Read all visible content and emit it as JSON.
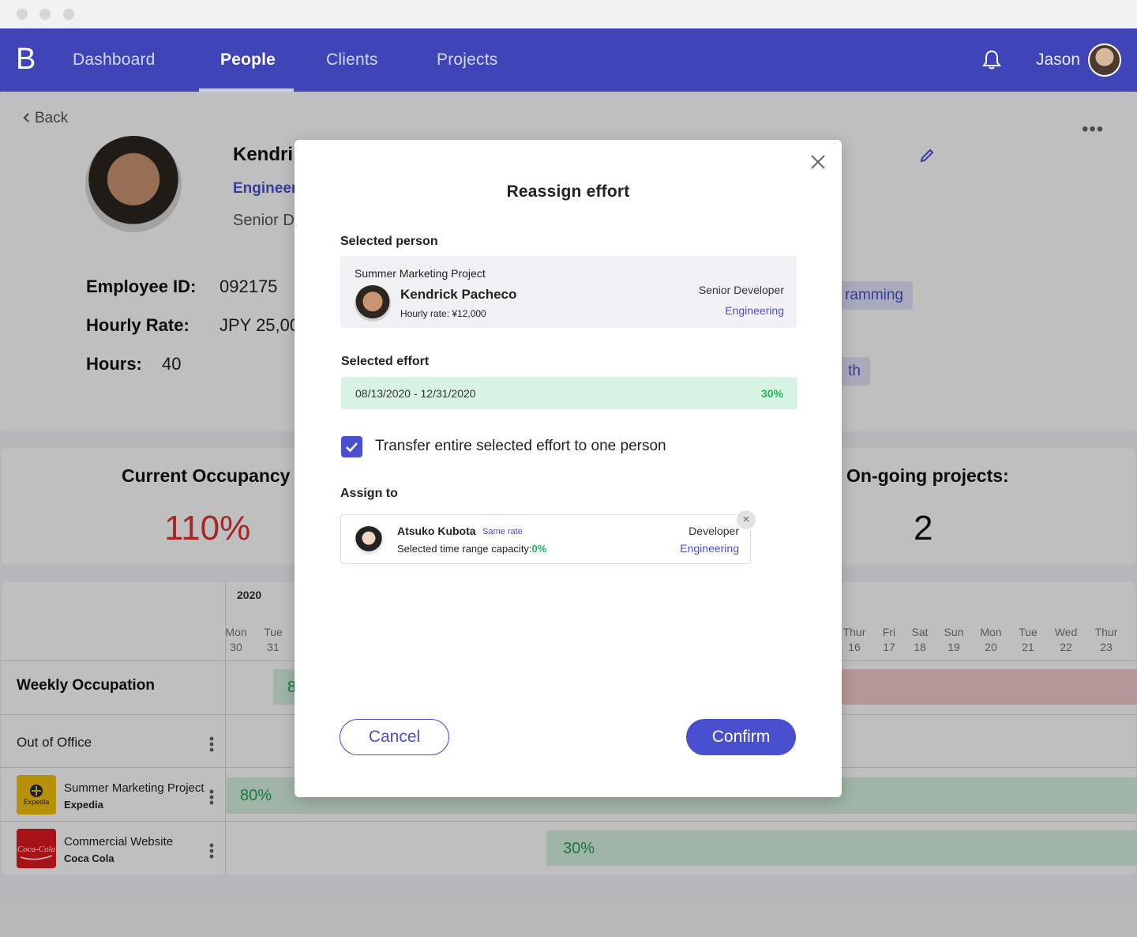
{
  "nav": {
    "logo": "B",
    "items": [
      "Dashboard",
      "People",
      "Clients",
      "Projects"
    ],
    "active": "People",
    "user_name": "Jason"
  },
  "profile": {
    "back_label": "Back",
    "name_visible": "Kendri",
    "dept_visible": "Engineer",
    "role_visible": "Senior D",
    "employee_id_label": "Employee ID:",
    "employee_id": "092175",
    "hourly_rate_label": "Hourly Rate:",
    "hourly_rate_visible": "JPY 25,00",
    "hours_label": "Hours:",
    "hours": "40",
    "skills_visible": [
      "ramming",
      "th"
    ]
  },
  "stats": {
    "occupancy_title": "Current Occupancy",
    "occupancy_value": "110%",
    "projects_title": "On-going projects:",
    "projects_value": "2"
  },
  "timeline": {
    "year": "2020",
    "days": [
      {
        "dow": "Mon",
        "date": "30"
      },
      {
        "dow": "Tue",
        "date": "31"
      },
      {
        "dow": "Thur",
        "date": "16"
      },
      {
        "dow": "Fri",
        "date": "17"
      },
      {
        "dow": "Sat",
        "date": "18"
      },
      {
        "dow": "Sun",
        "date": "19"
      },
      {
        "dow": "Mon",
        "date": "20"
      },
      {
        "dow": "Tue",
        "date": "21"
      },
      {
        "dow": "Wed",
        "date": "22"
      },
      {
        "dow": "Thur",
        "date": "23"
      }
    ],
    "rows": {
      "weekly": {
        "label": "Weekly Occupation",
        "bar_visible": "8"
      },
      "ooo": {
        "label": "Out of Office"
      },
      "proj1": {
        "name": "Summer Marketing Project",
        "client": "Expedia",
        "logo_text": "Expedia",
        "percent": "80%"
      },
      "proj2": {
        "name": "Commercial Website",
        "client": "Coca Cola",
        "logo_text": "Coca-Cola",
        "percent": "30%"
      }
    }
  },
  "modal": {
    "title": "Reassign effort",
    "selected_person_label": "Selected person",
    "person": {
      "project": "Summer Marketing Project",
      "name": "Kendrick Pacheco",
      "rate": "Hourly rate: ¥12,000",
      "role": "Senior Developer",
      "dept": "Engineering"
    },
    "selected_effort_label": "Selected effort",
    "effort": {
      "range": "08/13/2020 - 12/31/2020",
      "percent": "30%"
    },
    "transfer_checked": true,
    "transfer_label": "Transfer entire selected effort to one person",
    "assign_to_label": "Assign to",
    "assignee": {
      "name": "Atsuko Kubota",
      "rate_tag": "Same rate",
      "capacity_label": "Selected time range capacity:",
      "capacity_value": "0%",
      "role": "Developer",
      "dept": "Engineering"
    },
    "cancel_label": "Cancel",
    "confirm_label": "Confirm"
  },
  "colors": {
    "nav_bg": "#3f44b7",
    "accent": "#4a4fd0",
    "danger": "#dd3333",
    "success": "#22b45a",
    "effort_bg": "#d7f3e3"
  },
  "icons": [
    "bell-icon",
    "pencil-icon",
    "close-icon",
    "check-icon",
    "chevron-left-icon",
    "more-icon",
    "kebab-icon"
  ]
}
